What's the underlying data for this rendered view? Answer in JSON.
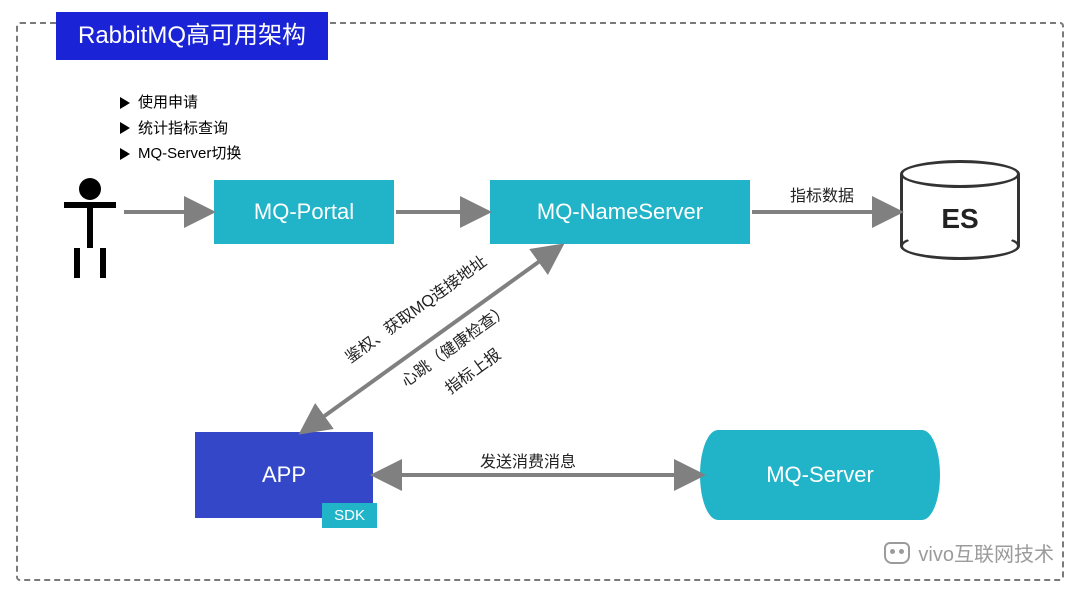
{
  "title": "RabbitMQ高可用架构",
  "bullets": [
    "使用申请",
    "统计指标查询",
    "MQ-Server切换"
  ],
  "nodes": {
    "user": {
      "name": "user-actor"
    },
    "portal": {
      "label": "MQ-Portal",
      "color": "#21b4c8"
    },
    "nameserver": {
      "label": "MQ-NameServer",
      "color": "#21b4c8"
    },
    "es": {
      "label": "ES"
    },
    "app": {
      "label": "APP",
      "color": "#3447c8",
      "sdk_label": "SDK"
    },
    "server": {
      "label": "MQ-Server",
      "color": "#21b4c8"
    }
  },
  "edges": {
    "user_to_portal": {
      "direction": "one-way"
    },
    "portal_to_nameserver": {
      "direction": "one-way"
    },
    "nameserver_to_es": {
      "label": "指标数据",
      "direction": "one-way"
    },
    "nameserver_app": {
      "direction": "two-way",
      "label_top": "鉴权、获取MQ连接地址",
      "label_mid": "心跳（健康检查）",
      "label_bot": "指标上报"
    },
    "app_server": {
      "label": "发送消费消息",
      "direction": "two-way"
    }
  },
  "watermark": "vivo互联网技术"
}
